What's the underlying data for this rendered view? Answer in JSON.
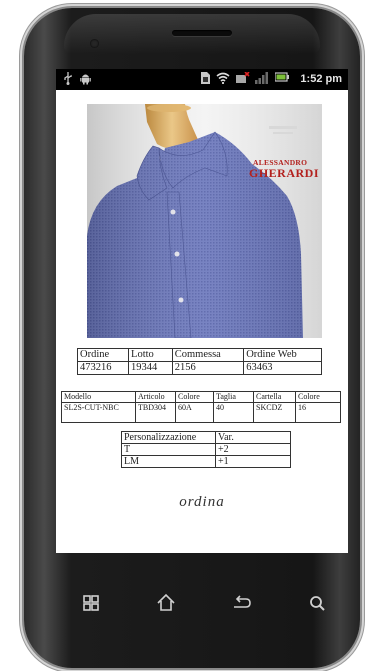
{
  "statusbar": {
    "icons": [
      "usb-icon",
      "android-debug-icon",
      "sim-card-icon",
      "wifi-icon",
      "no-signal-icon",
      "signal-bars-icon",
      "battery-icon"
    ],
    "time": "1:52 pm"
  },
  "product": {
    "brand_line1": "ALESSANDRO",
    "brand_line2": "GHERARDI"
  },
  "order_table": {
    "headers": [
      "Ordine",
      "Lotto",
      "Commessa",
      "Ordine Web"
    ],
    "values": [
      "473216",
      "19344",
      "2156",
      "63463"
    ]
  },
  "article_table": {
    "headers": [
      "Modello",
      "Articolo",
      "Colore",
      "Taglia",
      "Cartella",
      "Colore"
    ],
    "values": [
      "SL2S-CUT-NBC",
      "TBD304",
      "60A",
      "40",
      "SKCDZ",
      "16"
    ]
  },
  "personalization_table": {
    "headers": [
      "Personalizzazione",
      "Var."
    ],
    "rows": [
      {
        "name": "T",
        "var": "+2"
      },
      {
        "name": "LM",
        "var": "+1"
      }
    ]
  },
  "order_link": "ordina",
  "navbar": {
    "icons": [
      "recent-apps-icon",
      "home-icon",
      "back-icon",
      "search-icon"
    ]
  },
  "colors": {
    "shirt_blue": "#5f6cb4",
    "brand_red": "#b3211e",
    "bezel": "#1a1a1a"
  }
}
